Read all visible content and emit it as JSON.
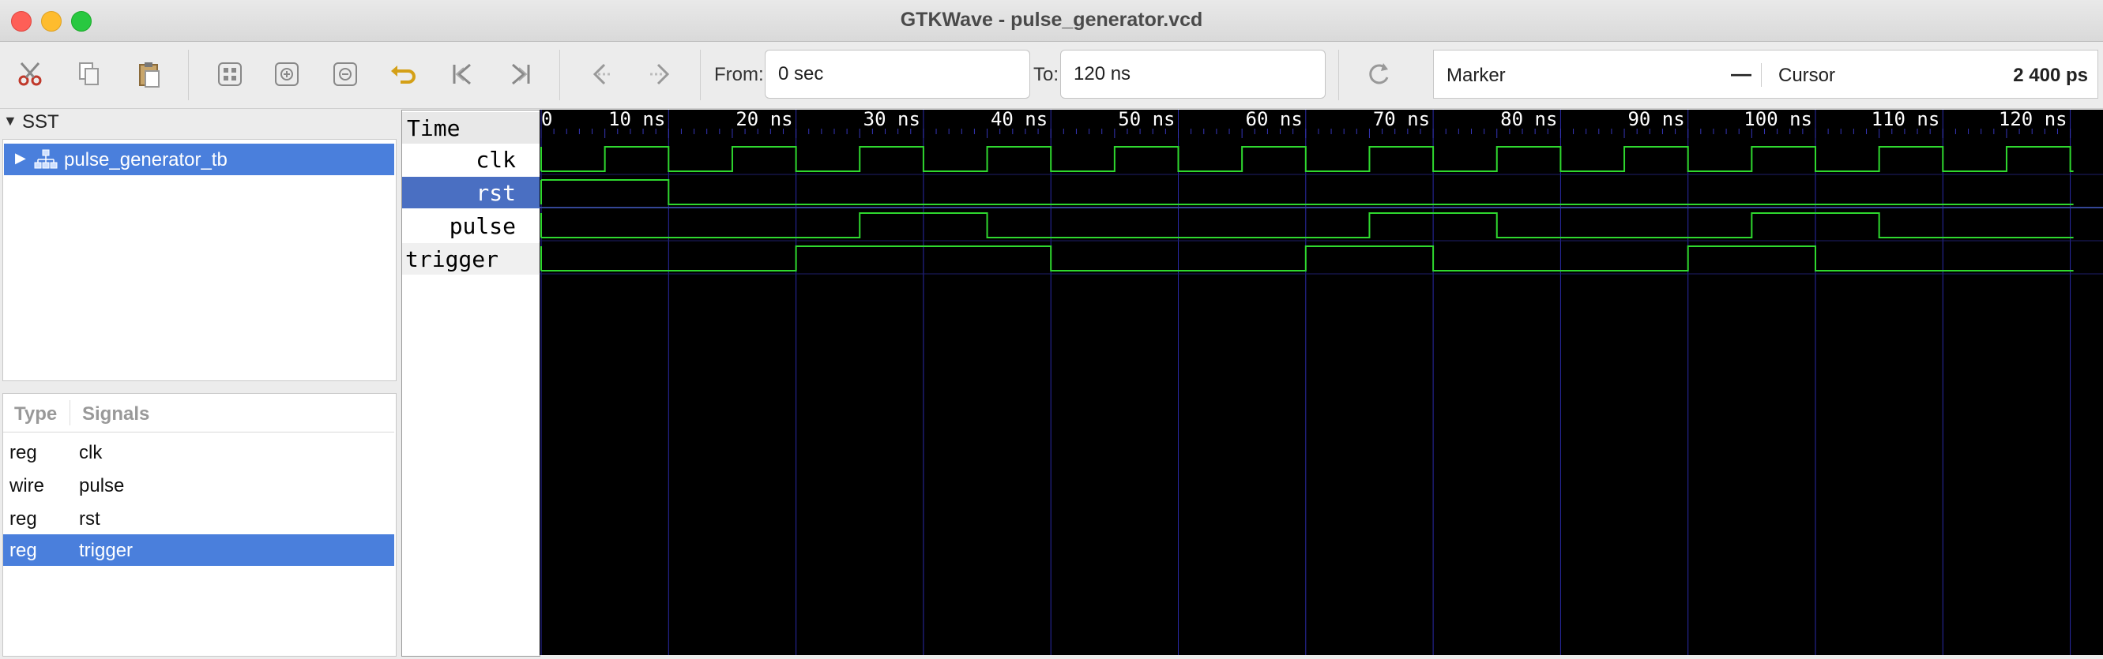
{
  "window": {
    "title": "GTKWave - pulse_generator.vcd"
  },
  "toolbar": {
    "icons": [
      "cut-icon",
      "copy-icon",
      "paste-icon",
      "zoom-fit-icon",
      "zoom-in-icon",
      "zoom-out-icon",
      "undo-zoom-icon",
      "zoom-begin-icon",
      "zoom-end-icon",
      "prev-edge-icon",
      "next-edge-icon",
      "reload-icon"
    ],
    "from_label": "From:",
    "from_value": "0 sec",
    "to_label": "To:",
    "to_value": "120 ns",
    "marker_label": "Marker",
    "marker_value": "—",
    "cursor_label": "Cursor",
    "cursor_value": "2 400 ps"
  },
  "sst": {
    "title": "SST",
    "tree": [
      {
        "label": "pulse_generator_tb",
        "selected": true
      }
    ]
  },
  "signals_list": {
    "headers": {
      "type": "Type",
      "signals": "Signals"
    },
    "rows": [
      {
        "type": "reg",
        "name": "clk",
        "selected": false
      },
      {
        "type": "wire",
        "name": "pulse",
        "selected": false
      },
      {
        "type": "reg",
        "name": "rst",
        "selected": false
      },
      {
        "type": "reg",
        "name": "trigger",
        "selected": true
      }
    ]
  },
  "waveform": {
    "time_label": "Time",
    "ticks": [
      "0",
      "10 ns",
      "20 ns",
      "30 ns",
      "40 ns",
      "50 ns",
      "60 ns",
      "70 ns",
      "80 ns",
      "90 ns",
      "100 ns",
      "110 ns",
      "120 ns"
    ],
    "time_range_ns": [
      0,
      120
    ],
    "colors": {
      "background": "#000000",
      "wave": "#2fd82f",
      "grid": "#2a2aa8",
      "selected_row": "#4a6fc2"
    },
    "signals": [
      {
        "name": "clk",
        "selected": false,
        "initial": 0,
        "toggles_ns": [
          5,
          10,
          15,
          20,
          25,
          30,
          35,
          40,
          45,
          50,
          55,
          60,
          65,
          70,
          75,
          80,
          85,
          90,
          95,
          100,
          105,
          110,
          115,
          120
        ]
      },
      {
        "name": "rst",
        "selected": true,
        "initial": 1,
        "toggles_ns": [
          10
        ]
      },
      {
        "name": "pulse",
        "selected": false,
        "initial": 0,
        "toggles_ns": [
          25,
          35,
          65,
          75,
          95,
          105
        ]
      },
      {
        "name": "trigger",
        "selected": false,
        "initial": 0,
        "toggles_ns": [
          20,
          40,
          60,
          70,
          90,
          100
        ]
      }
    ]
  }
}
